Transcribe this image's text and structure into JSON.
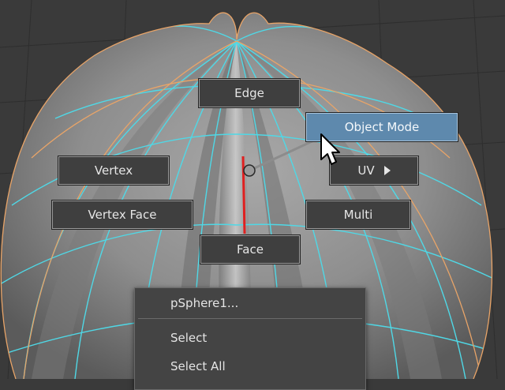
{
  "colors": {
    "background": "#3a3a3a",
    "wire_cyan": "#4fd8e6",
    "wire_orange": "#e8a468",
    "selected_edge": "#e02020",
    "active_item": "#5e89ad"
  },
  "marking_menu": {
    "north": {
      "label": "Edge"
    },
    "northeast": {
      "label": "Object Mode",
      "highlighted": true
    },
    "west": {
      "label": "Vertex"
    },
    "east": {
      "label": "UV",
      "submenu_icon": "triangle-right-icon"
    },
    "southwest": {
      "label": "Vertex Face"
    },
    "southeast": {
      "label": "Multi"
    },
    "south": {
      "label": "Face"
    }
  },
  "context_menu": {
    "title": "pSphere1...",
    "items": [
      {
        "label": "Select"
      },
      {
        "label": "Select All"
      }
    ]
  },
  "cursor_icon": "arrow-pointer-icon",
  "center_icon": "marking-menu-center-circle-icon"
}
